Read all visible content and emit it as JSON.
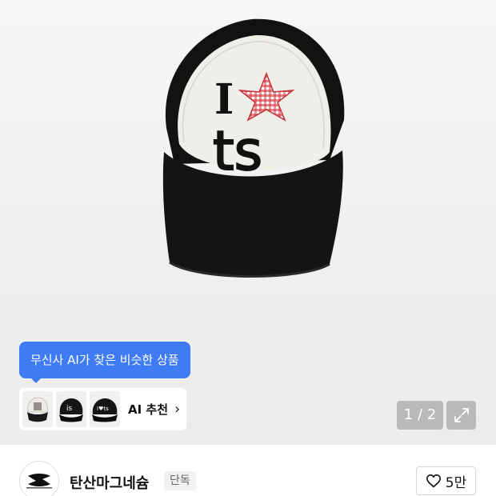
{
  "gallery": {
    "cap_lettering_top": "I",
    "cap_lettering_bottom": "ts",
    "page_indicator": "1 / 2",
    "expand_icon": "expand-arrows-icon"
  },
  "ai_recommendation": {
    "tooltip": "무신사 AI가 찾은 비슷한 상품",
    "label": "AI 추천",
    "thumb_texts": [
      "is",
      "I♥ts"
    ],
    "chevron_icon": "chevron-right-icon"
  },
  "brand": {
    "name": "탄산마그네슘",
    "badge": "단독",
    "logo_icon": "brand-logo-icon"
  },
  "like": {
    "icon": "heart-outline-icon",
    "count": "5만"
  },
  "colors": {
    "accent_blue": "#3f7bf5",
    "cap_black": "#111111",
    "cap_white": "#efeee8",
    "star_red": "#d8323a",
    "overlay_gray": "#b9b9b9"
  }
}
